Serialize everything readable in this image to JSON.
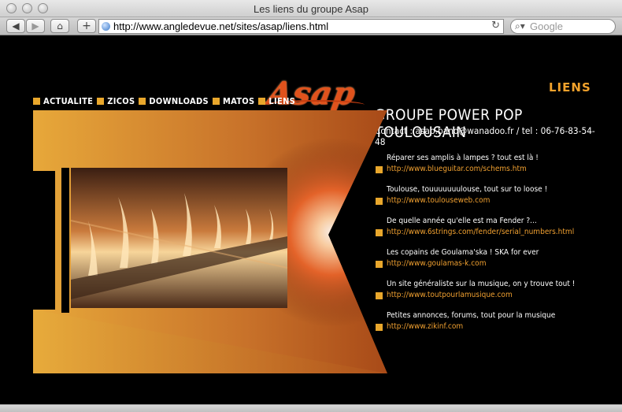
{
  "window": {
    "title": "Les liens du groupe Asap"
  },
  "toolbar": {
    "back_icon": "back-arrow-icon",
    "forward_icon": "forward-arrow-icon",
    "home_icon": "home-icon",
    "add_icon": "plus-icon",
    "url": "http://www.angledevue.net/sites/asap/liens.html",
    "search_placeholder": "Google"
  },
  "site": {
    "logo": "Asap",
    "section_title": "LIENS",
    "headline": "GROUPE POWER POP TOULOUSAIN",
    "contact": "Contact : asap.band@wanadoo.fr / tel : 06-76-83-54-48",
    "accent_color": "#e9a72c"
  },
  "nav": [
    {
      "label": "ACTUALITE"
    },
    {
      "label": "ZICOS"
    },
    {
      "label": "DOWNLOADS"
    },
    {
      "label": "MATOS"
    },
    {
      "label": "LIENS"
    }
  ],
  "links": [
    {
      "desc": "Réparer ses amplis à lampes ? tout est là !",
      "url": "http://www.blueguitar.com/schems.htm"
    },
    {
      "desc": "Toulouse, touuuuuuulouse, tout sur to loose !",
      "url": "http://www.toulouseweb.com"
    },
    {
      "desc": "De quelle année qu'elle est ma Fender ?...",
      "url": "http://www.6strings.com/fender/serial_numbers.html"
    },
    {
      "desc": "Les copains de Goulama'ska ! SKA for ever",
      "url": "http://www.goulamas-k.com"
    },
    {
      "desc": "Un site généraliste sur la musique, on  y trouve tout !",
      "url": "http://www.toutpourlamusique.com"
    },
    {
      "desc": "Petites annonces, forums, tout pour la musique",
      "url": "http://www.zikinf.com"
    }
  ]
}
